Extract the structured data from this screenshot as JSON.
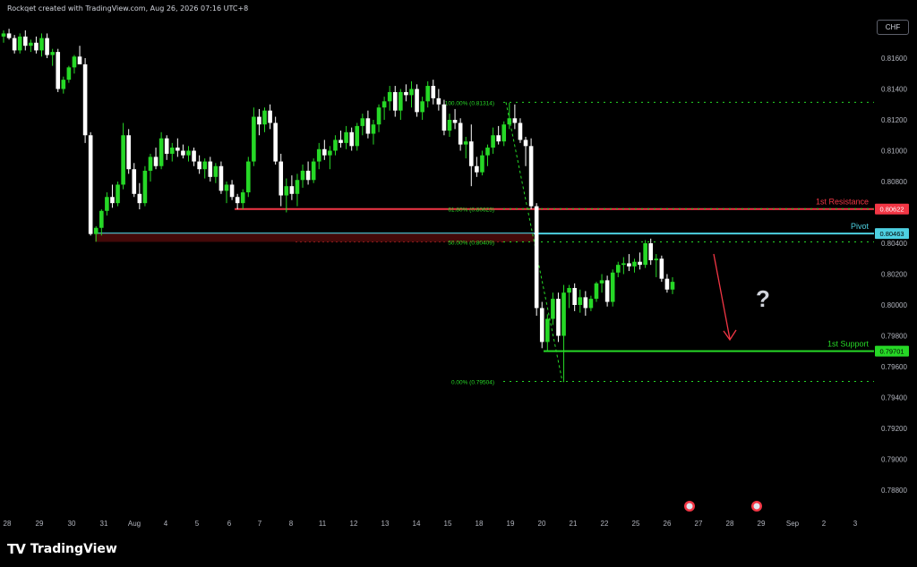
{
  "header": {
    "attribution": "Rockqet created with TradingView.com, Aug 26, 2026 07:16 UTC+8"
  },
  "currency_button": {
    "label": "CHF"
  },
  "brand": {
    "name": "TradingView",
    "icon": "tradingview-logo-icon"
  },
  "chart_data": {
    "type": "candlestick",
    "y_ticks": [
      "0.81600",
      "0.81400",
      "0.81200",
      "0.81000",
      "0.80800",
      "0.80400",
      "0.80200",
      "0.80000",
      "0.79800",
      "0.79600",
      "0.79400",
      "0.79200",
      "0.79000",
      "0.78800"
    ],
    "x_ticks": [
      "28",
      "29",
      "30",
      "31",
      "Aug",
      "4",
      "5",
      "6",
      "7",
      "8",
      "11",
      "12",
      "13",
      "14",
      "15",
      "18",
      "19",
      "20",
      "21",
      "22",
      "25",
      "26",
      "27",
      "28",
      "29",
      "Sep",
      "2",
      "3"
    ],
    "levels": [
      {
        "label": "1st Resistance",
        "price_label": "0.80622",
        "value": 0.80622,
        "color": "#f23645"
      },
      {
        "label": "Pivot",
        "price_label": "0.80463",
        "value": 0.80463,
        "color": "#4dd0e1"
      },
      {
        "label": "1st Support",
        "price_label": "0.79701",
        "value": 0.79701,
        "color": "#26d826"
      }
    ],
    "fib_levels": [
      {
        "label": "100.00% (0.81314)",
        "value": 0.81314
      },
      {
        "label": "61.80% (0.80623)",
        "value": 0.80623
      },
      {
        "label": "50.00% (0.80409)",
        "value": 0.80409
      },
      {
        "label": "0.00% (0.79504)",
        "value": 0.79504
      }
    ],
    "annotation": "?",
    "bull_color": "#26d826",
    "bear_color": "#ffffff",
    "candles": [
      [
        0.8174,
        0.8178,
        0.817,
        0.8176
      ],
      [
        0.8176,
        0.8179,
        0.8172,
        0.8173
      ],
      [
        0.8173,
        0.8175,
        0.8163,
        0.8165
      ],
      [
        0.8165,
        0.8176,
        0.8163,
        0.8174
      ],
      [
        0.8174,
        0.8178,
        0.8165,
        0.8168
      ],
      [
        0.8168,
        0.8172,
        0.8164,
        0.817
      ],
      [
        0.817,
        0.8174,
        0.8163,
        0.8165
      ],
      [
        0.8165,
        0.8176,
        0.8161,
        0.8173
      ],
      [
        0.8173,
        0.8176,
        0.816,
        0.8162
      ],
      [
        0.8162,
        0.8166,
        0.8155,
        0.8164
      ],
      [
        0.8164,
        0.8166,
        0.8138,
        0.814
      ],
      [
        0.814,
        0.8148,
        0.8137,
        0.8146
      ],
      [
        0.8146,
        0.8155,
        0.8144,
        0.8154
      ],
      [
        0.8154,
        0.8162,
        0.815,
        0.8161
      ],
      [
        0.8161,
        0.8168,
        0.8158,
        0.8156
      ],
      [
        0.8156,
        0.816,
        0.8105,
        0.811
      ],
      [
        0.811,
        0.8112,
        0.8045,
        0.8046
      ],
      [
        0.8046,
        0.8051,
        0.8041,
        0.805
      ],
      [
        0.805,
        0.8062,
        0.8045,
        0.8061
      ],
      [
        0.8061,
        0.8073,
        0.8058,
        0.807
      ],
      [
        0.807,
        0.8078,
        0.8063,
        0.8066
      ],
      [
        0.8066,
        0.808,
        0.8064,
        0.8078
      ],
      [
        0.8078,
        0.8118,
        0.8075,
        0.811
      ],
      [
        0.811,
        0.8114,
        0.8085,
        0.8088
      ],
      [
        0.8088,
        0.8092,
        0.807,
        0.8072
      ],
      [
        0.8072,
        0.8079,
        0.8062,
        0.8066
      ],
      [
        0.8066,
        0.809,
        0.8064,
        0.8087
      ],
      [
        0.8087,
        0.8098,
        0.808,
        0.8096
      ],
      [
        0.8096,
        0.8102,
        0.8088,
        0.809
      ],
      [
        0.809,
        0.8112,
        0.8088,
        0.8108
      ],
      [
        0.8108,
        0.811,
        0.8094,
        0.8098
      ],
      [
        0.8098,
        0.8105,
        0.8093,
        0.8102
      ],
      [
        0.8102,
        0.8108,
        0.8096,
        0.81
      ],
      [
        0.81,
        0.8104,
        0.8095,
        0.8097
      ],
      [
        0.8097,
        0.8103,
        0.8093,
        0.81
      ],
      [
        0.81,
        0.8102,
        0.809,
        0.8093
      ],
      [
        0.8093,
        0.8097,
        0.8085,
        0.8088
      ],
      [
        0.8088,
        0.8095,
        0.8082,
        0.8093
      ],
      [
        0.8093,
        0.8096,
        0.808,
        0.8083
      ],
      [
        0.8083,
        0.8092,
        0.8079,
        0.809
      ],
      [
        0.809,
        0.8093,
        0.8072,
        0.8074
      ],
      [
        0.8074,
        0.808,
        0.8066,
        0.8078
      ],
      [
        0.8078,
        0.8081,
        0.8068,
        0.807
      ],
      [
        0.807,
        0.8072,
        0.8062,
        0.8066
      ],
      [
        0.8066,
        0.8075,
        0.8062,
        0.8073
      ],
      [
        0.8073,
        0.8096,
        0.807,
        0.8093
      ],
      [
        0.8093,
        0.8128,
        0.809,
        0.8122
      ],
      [
        0.8122,
        0.8127,
        0.811,
        0.8117
      ],
      [
        0.8117,
        0.8128,
        0.8112,
        0.8126
      ],
      [
        0.8126,
        0.813,
        0.8114,
        0.8118
      ],
      [
        0.8118,
        0.8122,
        0.8091,
        0.8093
      ],
      [
        0.8093,
        0.8098,
        0.8064,
        0.8071
      ],
      [
        0.8071,
        0.8082,
        0.806,
        0.8077
      ],
      [
        0.8077,
        0.8084,
        0.8068,
        0.8072
      ],
      [
        0.8072,
        0.8085,
        0.8064,
        0.8081
      ],
      [
        0.8081,
        0.8091,
        0.8076,
        0.8087
      ],
      [
        0.8087,
        0.8093,
        0.8078,
        0.8081
      ],
      [
        0.8081,
        0.8095,
        0.8079,
        0.8093
      ],
      [
        0.8093,
        0.8105,
        0.8088,
        0.8101
      ],
      [
        0.8101,
        0.8107,
        0.8094,
        0.8097
      ],
      [
        0.8097,
        0.8103,
        0.8088,
        0.81
      ],
      [
        0.81,
        0.811,
        0.8097,
        0.8107
      ],
      [
        0.8107,
        0.8113,
        0.8102,
        0.8105
      ],
      [
        0.8105,
        0.8116,
        0.8101,
        0.8112
      ],
      [
        0.8112,
        0.8115,
        0.81,
        0.8103
      ],
      [
        0.8103,
        0.8118,
        0.81,
        0.8116
      ],
      [
        0.8116,
        0.8124,
        0.811,
        0.8121
      ],
      [
        0.8121,
        0.8126,
        0.8108,
        0.8111
      ],
      [
        0.8111,
        0.812,
        0.8104,
        0.8117
      ],
      [
        0.8117,
        0.813,
        0.8112,
        0.8128
      ],
      [
        0.8128,
        0.8135,
        0.812,
        0.8132
      ],
      [
        0.8132,
        0.8142,
        0.8126,
        0.8138
      ],
      [
        0.8138,
        0.8142,
        0.8122,
        0.8126
      ],
      [
        0.8126,
        0.814,
        0.812,
        0.8138
      ],
      [
        0.8138,
        0.8143,
        0.8132,
        0.8136
      ],
      [
        0.8136,
        0.8145,
        0.8128,
        0.814
      ],
      [
        0.814,
        0.8143,
        0.8122,
        0.8125
      ],
      [
        0.8125,
        0.8135,
        0.812,
        0.8132
      ],
      [
        0.8132,
        0.8145,
        0.8128,
        0.8142
      ],
      [
        0.8142,
        0.8146,
        0.813,
        0.8134
      ],
      [
        0.8134,
        0.814,
        0.8126,
        0.813
      ],
      [
        0.813,
        0.8133,
        0.811,
        0.8113
      ],
      [
        0.8113,
        0.8124,
        0.8109,
        0.812
      ],
      [
        0.812,
        0.8127,
        0.8114,
        0.8118
      ],
      [
        0.8118,
        0.8121,
        0.81,
        0.8104
      ],
      [
        0.8104,
        0.8109,
        0.8095,
        0.8106
      ],
      [
        0.8106,
        0.8117,
        0.8077,
        0.809
      ],
      [
        0.809,
        0.8096,
        0.8083,
        0.8086
      ],
      [
        0.8086,
        0.81,
        0.8084,
        0.8097
      ],
      [
        0.8097,
        0.8104,
        0.809,
        0.8102
      ],
      [
        0.8102,
        0.8115,
        0.8098,
        0.811
      ],
      [
        0.811,
        0.8116,
        0.8104,
        0.8106
      ],
      [
        0.8106,
        0.8119,
        0.8103,
        0.8117
      ],
      [
        0.8117,
        0.8131,
        0.8114,
        0.8121
      ],
      [
        0.8121,
        0.813,
        0.8114,
        0.8118
      ],
      [
        0.8118,
        0.8121,
        0.8105,
        0.8107
      ],
      [
        0.8107,
        0.8109,
        0.809,
        0.8103
      ],
      [
        0.8103,
        0.8108,
        0.8062,
        0.8064
      ],
      [
        0.8064,
        0.8066,
        0.7993,
        0.7998
      ],
      [
        0.7998,
        0.8002,
        0.7972,
        0.7976
      ],
      [
        0.7976,
        0.7994,
        0.797,
        0.7991
      ],
      [
        0.7991,
        0.8008,
        0.7987,
        0.8004
      ],
      [
        0.8004,
        0.8008,
        0.7976,
        0.798
      ],
      [
        0.798,
        0.8013,
        0.795,
        0.8008
      ],
      [
        0.8008,
        0.8013,
        0.7998,
        0.8011
      ],
      [
        0.8011,
        0.8014,
        0.7996,
        0.8
      ],
      [
        0.8,
        0.801,
        0.7995,
        0.8005
      ],
      [
        0.8005,
        0.8009,
        0.7993,
        0.7998
      ],
      [
        0.7998,
        0.8006,
        0.7996,
        0.8004
      ],
      [
        0.8004,
        0.8015,
        0.8002,
        0.8014
      ],
      [
        0.8014,
        0.802,
        0.8008,
        0.8016
      ],
      [
        0.8016,
        0.8019,
        0.7999,
        0.8002
      ],
      [
        0.8002,
        0.8023,
        0.7999,
        0.8021
      ],
      [
        0.8021,
        0.8028,
        0.8018,
        0.8026
      ],
      [
        0.8026,
        0.8031,
        0.802,
        0.8027
      ],
      [
        0.8027,
        0.8033,
        0.8022,
        0.8025
      ],
      [
        0.8025,
        0.803,
        0.8021,
        0.8028
      ],
      [
        0.8028,
        0.8034,
        0.8023,
        0.8026
      ],
      [
        0.8026,
        0.8042,
        0.8024,
        0.804
      ],
      [
        0.804,
        0.8043,
        0.8026,
        0.8029
      ],
      [
        0.8029,
        0.8033,
        0.8018,
        0.803
      ],
      [
        0.803,
        0.8032,
        0.8015,
        0.8017
      ],
      [
        0.8017,
        0.802,
        0.8008,
        0.801
      ],
      [
        0.801,
        0.8018,
        0.8007,
        0.8015
      ]
    ]
  }
}
